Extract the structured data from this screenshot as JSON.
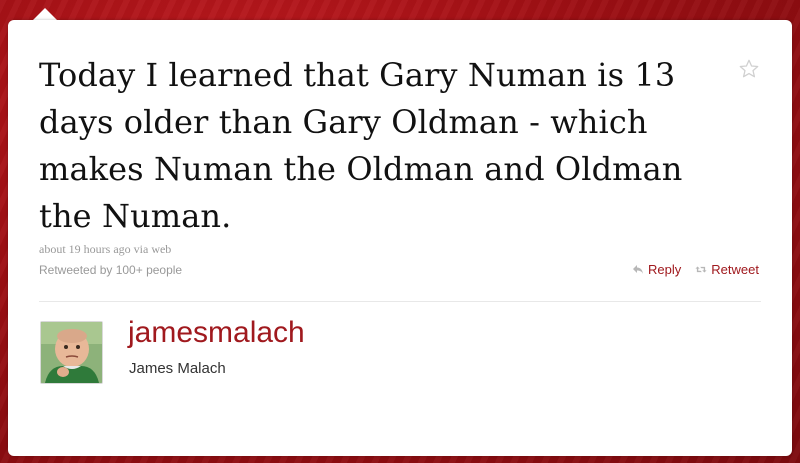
{
  "tweet": {
    "text": "Today I learned that Gary Numan is 13 days older than Gary Oldman - which makes Numan the Oldman and Oldman the Numan.",
    "timestamp": "about 19 hours ago via web",
    "retweeted_by": "Retweeted by 100+ people"
  },
  "actions": {
    "reply_label": "Reply",
    "retweet_label": "Retweet"
  },
  "author": {
    "username": "jamesmalach",
    "full_name": "James Malach"
  },
  "icons": {
    "favorite": "star-icon",
    "reply": "reply-icon",
    "retweet": "retweet-icon"
  },
  "colors": {
    "accent": "#a0191e",
    "background": "#9e0f14",
    "meta_text": "#999999"
  }
}
